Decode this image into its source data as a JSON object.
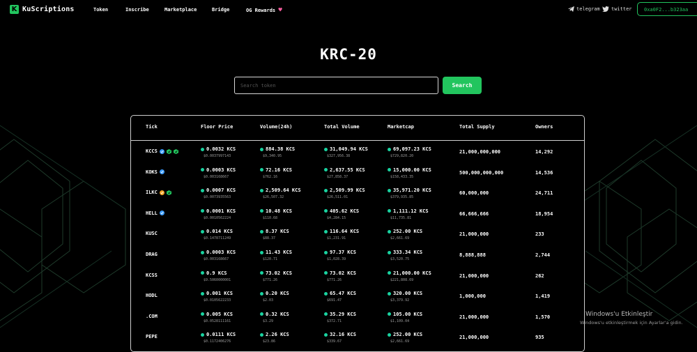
{
  "nav": {
    "brand": "KuScriptions",
    "links": [
      "Token",
      "Inscribe",
      "Marketplace",
      "Bridge",
      "OG Rewards"
    ],
    "telegram": "telegram",
    "twitter": "twitter",
    "wallet": "0xa0F2...b323aa"
  },
  "hero": {
    "title": "KRC-20",
    "search_placeholder": "Search token",
    "search_button": "Search"
  },
  "table": {
    "headers": [
      "Tick",
      "Floor Price",
      "Volume(24h)",
      "Total Volume",
      "Marketcap",
      "Total Supply",
      "Owners"
    ],
    "rows": [
      {
        "tick": "KCCS",
        "badges": [
          "verified",
          "kcc",
          "kcc"
        ],
        "floor": "0.0032 KCS",
        "floor_sub": "$0.0037997143",
        "vol24": "884.38 KCS",
        "vol24_sub": "$9,340.95",
        "total": "31,049.94 KCS",
        "total_sub": "$327,956.38",
        "mcap": "69,097.23 KCS",
        "mcap_sub": "$729,820.20",
        "supply": "21,000,000,000",
        "owners": "14,292"
      },
      {
        "tick": "KOKS",
        "badges": [
          "verified"
        ],
        "floor": "0.0003 KCS",
        "floor_sub": "$0.003168667",
        "vol24": "72.16 KCS",
        "vol24_sub": "$762.16",
        "total": "2,637.55 KCS",
        "total_sub": "$27,858.37",
        "mcap": "15,000.00 KCS",
        "mcap_sub": "$158,433.35",
        "supply": "500,000,000,000",
        "owners": "14,536"
      },
      {
        "tick": "ILKC",
        "badges": [
          "orange",
          "kcc"
        ],
        "floor": "0.0007 KCS",
        "floor_sub": "$0.0073935563",
        "vol24": "2,509.64 KCS",
        "vol24_sub": "$26,507.32",
        "total": "2,509.99 KCS",
        "total_sub": "$26,511.01",
        "mcap": "35,971.20 KCS",
        "mcap_sub": "$379,935.85",
        "supply": "60,000,000",
        "owners": "24,711"
      },
      {
        "tick": "HELL",
        "badges": [
          "verified"
        ],
        "floor": "0.0001 KCS",
        "floor_sub": "$0.0010562224",
        "vol24": "10.48 KCS",
        "vol24_sub": "$110.68",
        "total": "405.62 KCS",
        "total_sub": "$4,284.15",
        "mcap": "1,111.12 KCS",
        "mcap_sub": "$11,735.81",
        "supply": "66,666,666",
        "owners": "18,954"
      },
      {
        "tick": "KUSC",
        "badges": [],
        "floor": "0.014 KCS",
        "floor_sub": "$0.1478711249",
        "vol24": "8.37 KCS",
        "vol24_sub": "$88.37",
        "total": "116.64 KCS",
        "total_sub": "$1,231.91",
        "mcap": "252.00 KCS",
        "mcap_sub": "$2,661.69",
        "supply": "21,000,000",
        "owners": "233"
      },
      {
        "tick": "DRAG",
        "badges": [],
        "floor": "0.0003 KCS",
        "floor_sub": "$0.003168667",
        "vol24": "11.43 KCS",
        "vol24_sub": "$120.71",
        "total": "97.37 KCS",
        "total_sub": "$1,028.39",
        "mcap": "333.34 KCS",
        "mcap_sub": "$3,520.75",
        "supply": "8,888,888",
        "owners": "2,744"
      },
      {
        "tick": "KCSS",
        "badges": [],
        "floor": "0.9 KCS",
        "floor_sub": "$9.5060000001",
        "vol24": "73.02 KCS",
        "vol24_sub": "$771.26",
        "total": "73.02 KCS",
        "total_sub": "$771.26",
        "mcap": "21,000.00 KCS",
        "mcap_sub": "$221,808.69",
        "supply": "21,000,000",
        "owners": "262"
      },
      {
        "tick": "HODL",
        "badges": [],
        "floor": "0.001 KCS",
        "floor_sub": "$0.0105622233",
        "vol24": "0.20 KCS",
        "vol24_sub": "$2.03",
        "total": "65.47 KCS",
        "total_sub": "$691.47",
        "mcap": "320.00 KCS",
        "mcap_sub": "$3,379.92",
        "supply": "1,000,000",
        "owners": "1,419"
      },
      {
        "tick": ".COM",
        "badges": [],
        "floor": "0.005 KCS",
        "floor_sub": "$0.0528111161",
        "vol24": "0.32 KCS",
        "vol24_sub": "$3.29",
        "total": "35.29 KCS",
        "total_sub": "$372.71",
        "mcap": "105.00 KCS",
        "mcap_sub": "$1,109.04",
        "supply": "21,000,000",
        "owners": "1,570"
      },
      {
        "tick": "PEPE",
        "badges": [],
        "floor": "0.0111 KCS",
        "floor_sub": "$0.1172406276",
        "vol24": "2.26 KCS",
        "vol24_sub": "$23.86",
        "total": "32.16 KCS",
        "total_sub": "$339.67",
        "mcap": "252.00 KCS",
        "mcap_sub": "$2,661.69",
        "supply": "21,000,000",
        "owners": "935"
      }
    ]
  },
  "watermark": {
    "line1": "Windows'u Etkinleştir",
    "line2": "Windows'u etkinleştirmek için Ayarlar'a gidin."
  },
  "colors": {
    "accent": "#22c55e",
    "dot": "#19d3a0",
    "verified": "#3b9cff",
    "orange": "#f5a623"
  }
}
